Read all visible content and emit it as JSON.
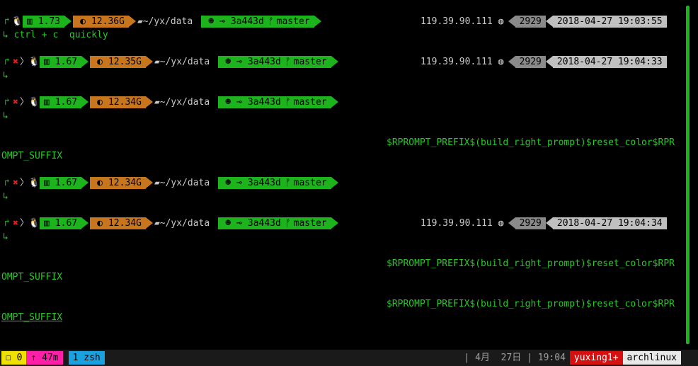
{
  "prompts": [
    {
      "status": "ok",
      "load": "1.73",
      "mem": "12.36G",
      "path": "~/yx/data",
      "commit": "3a443d",
      "branch": "master",
      "right": {
        "ip": "119.39.90.111",
        "num": "2929",
        "datetime": "2018-04-27 19:03:55"
      },
      "command": "ctrl + c  quickly"
    },
    {
      "status": "error",
      "load": "1.67",
      "mem": "12.35G",
      "path": "~/yx/data",
      "commit": "3a443d",
      "branch": "master",
      "right": {
        "ip": "119.39.90.111",
        "num": "2929",
        "datetime": "2018-04-27 19:04:33"
      },
      "command": ""
    },
    {
      "status": "error",
      "load": "1.67",
      "mem": "12.34G",
      "path": "~/yx/data",
      "commit": "3a443d",
      "branch": "master",
      "command": ""
    },
    {
      "status": "error",
      "load": "1.67",
      "mem": "12.34G",
      "path": "~/yx/data",
      "commit": "3a443d",
      "branch": "master",
      "command": ""
    },
    {
      "status": "error",
      "load": "1.67",
      "mem": "12.34G",
      "path": "~/yx/data",
      "commit": "3a443d",
      "branch": "master",
      "right": {
        "ip": "119.39.90.111",
        "num": "2929",
        "datetime": "2018-04-27 19:04:34"
      },
      "command": ""
    }
  ],
  "rprompt": {
    "line1": "$RPROMPT_PREFIX$(build_right_prompt)$reset_color$RPR",
    "line2": "OMPT_SUFFIX"
  },
  "statusbar": {
    "session": "0",
    "uptime": "↑ 47m",
    "window": "1 zsh",
    "date": "| 4月  27日 | 19:04",
    "user": "yuxing1+",
    "host": "archlinux"
  },
  "colors": {
    "green": "#1db31d",
    "orange": "#c8761e",
    "red": "#e02020",
    "yellow": "#f0e000",
    "magenta": "#ff1fa8",
    "blue": "#1aa2e0"
  }
}
